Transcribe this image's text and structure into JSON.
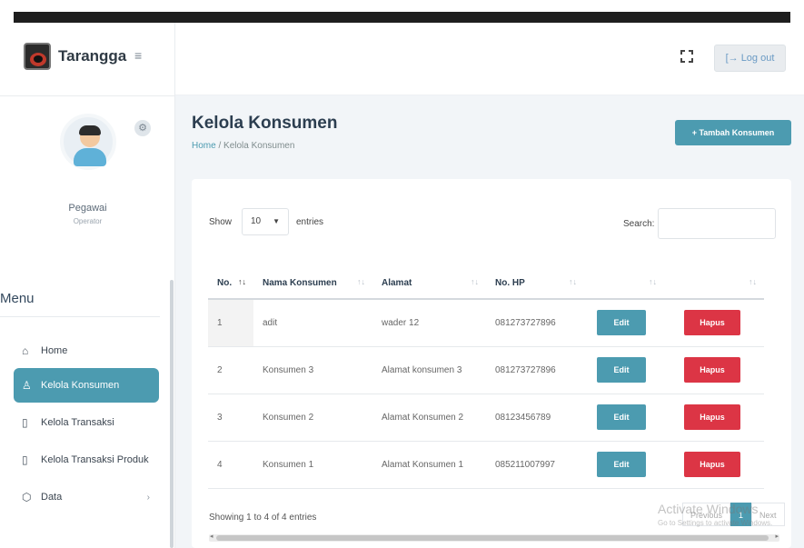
{
  "app": {
    "name": "Tarangga"
  },
  "header": {
    "logout_label": "[→ Log out"
  },
  "user": {
    "name": "Pegawai",
    "role": "Operator"
  },
  "menu": {
    "title": "Menu",
    "items": [
      {
        "label": "Home",
        "icon": "home-icon"
      },
      {
        "label": "Kelola Konsumen",
        "icon": "user-icon",
        "active": true
      },
      {
        "label": "Kelola Transaksi",
        "icon": "document-icon"
      },
      {
        "label": "Kelola Transaksi Produk",
        "icon": "document-icon"
      },
      {
        "label": "Data",
        "icon": "box-icon",
        "arrow": "›"
      }
    ]
  },
  "page": {
    "title": "Kelola Konsumen",
    "breadcrumb": {
      "home": "Home",
      "separator": " / ",
      "current": "Kelola Konsumen"
    },
    "add_button": "+ Tambah Konsumen"
  },
  "table_controls": {
    "show_label": "Show",
    "page_size": "10",
    "entries_label": "entries",
    "search_label": "Search:"
  },
  "table": {
    "headers": [
      "No.",
      "Nama Konsumen",
      "Alamat",
      "No. HP",
      "",
      ""
    ],
    "rows": [
      {
        "no": "1",
        "nama": "adit",
        "alamat": "wader 12",
        "hp": "081273727896",
        "edit": "Edit",
        "hapus": "Hapus"
      },
      {
        "no": "2",
        "nama": "Konsumen 3",
        "alamat": "Alamat konsumen 3",
        "hp": "081273727896",
        "edit": "Edit",
        "hapus": "Hapus"
      },
      {
        "no": "3",
        "nama": "Konsumen 2",
        "alamat": "Alamat Konsumen 2",
        "hp": "08123456789",
        "edit": "Edit",
        "hapus": "Hapus"
      },
      {
        "no": "4",
        "nama": "Konsumen 1",
        "alamat": "Alamat Konsumen 1",
        "hp": "085211007997",
        "edit": "Edit",
        "hapus": "Hapus"
      }
    ]
  },
  "footer": {
    "info": "Showing 1 to 4 of 4 entries",
    "pagination": {
      "previous": "Previous",
      "current": "1",
      "next": "Next"
    }
  },
  "watermark": {
    "line1": "Activate Windows",
    "line2": "Go to Settings to activate Windows."
  },
  "colors": {
    "accent": "#4c9bb0",
    "danger": "#dc3545",
    "content_bg": "#f2f5f8"
  }
}
